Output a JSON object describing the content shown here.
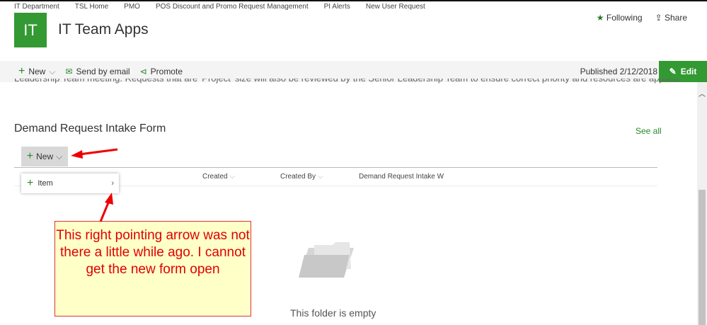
{
  "nav": [
    "IT Department",
    "TSL Home",
    "PMO",
    "POS Discount and Promo Request Management",
    "PI Alerts",
    "New User Request"
  ],
  "site": {
    "logo": "IT",
    "title": "IT Team Apps",
    "following": "Following",
    "share": "Share"
  },
  "commandbar": {
    "new": "New",
    "send": "Send by email",
    "promote": "Promote",
    "published": "Published 2/12/2018",
    "edit": "Edit"
  },
  "cut_text": "Leadership Team meeting. Requests that are 'Project' size will also be reviewed by the Senior Leadership Team to ensure correct priority and resources are applied.",
  "list": {
    "title": "Demand Request Intake Form",
    "see_all": "See all",
    "new": "New",
    "columns": [
      "Created",
      "Created By",
      "Demand Request Intake W"
    ],
    "menu_item": "Item",
    "empty": "This folder is empty"
  },
  "callout": "This right pointing arrow was not there a little while ago. I cannot get the new form open",
  "colors": {
    "accent": "#339933",
    "annotation": "#e00000"
  }
}
